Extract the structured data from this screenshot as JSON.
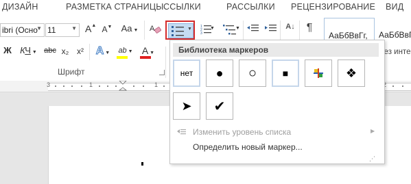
{
  "tabs": [
    "ДИЗАЙН",
    "РАЗМЕТКА СТРАНИЦЫ",
    "ССЫЛКИ",
    "РАССЫЛКИ",
    "РЕЦЕНЗИРОВАНИЕ",
    "ВИД"
  ],
  "font": {
    "name_value": "ibri (Осно",
    "size_value": "11",
    "grow_label": "A",
    "shrink_label": "A",
    "case_label": "Aa",
    "strike_label": "abc",
    "subscript_label": "x₂",
    "superscript_label": "x²",
    "effects_label": "A",
    "highlight_label": "ab",
    "color_label": "A",
    "bold_label": "Ж",
    "italic_label": "К",
    "underline_label": "Ч",
    "group_name": "Шрифт"
  },
  "paragraph": {
    "show_marks_label": "¶",
    "sort_label": "А↓"
  },
  "styles": {
    "preview1": "АаБбВвГг,",
    "preview2": "АаБбВвГг",
    "preview3": "Без инте"
  },
  "ruler_numbers": [
    "3",
    "1",
    "1",
    "2"
  ],
  "bullet_menu": {
    "header": "Библиотека маркеров",
    "none_label": "нет",
    "bullets": [
      {
        "name": "none",
        "symbol": "нет"
      },
      {
        "name": "filled-circle",
        "symbol": "●"
      },
      {
        "name": "hollow-circle",
        "symbol": "○"
      },
      {
        "name": "filled-square",
        "symbol": "■"
      },
      {
        "name": "four-color-cross",
        "symbol": "✢"
      },
      {
        "name": "diamond-cluster",
        "symbol": "❖"
      },
      {
        "name": "arrowhead",
        "symbol": "➤"
      },
      {
        "name": "checkmark",
        "symbol": "✔"
      }
    ],
    "change_level": "Изменить уровень списка",
    "define_new": "Определить новый маркер..."
  },
  "colors": {
    "highlight_bar": "#ffff00",
    "font_color_bar": "#e02020",
    "active_border": "#d42a2a",
    "active_fill": "#c5dcf2",
    "selected_border": "#c5d6ea"
  }
}
